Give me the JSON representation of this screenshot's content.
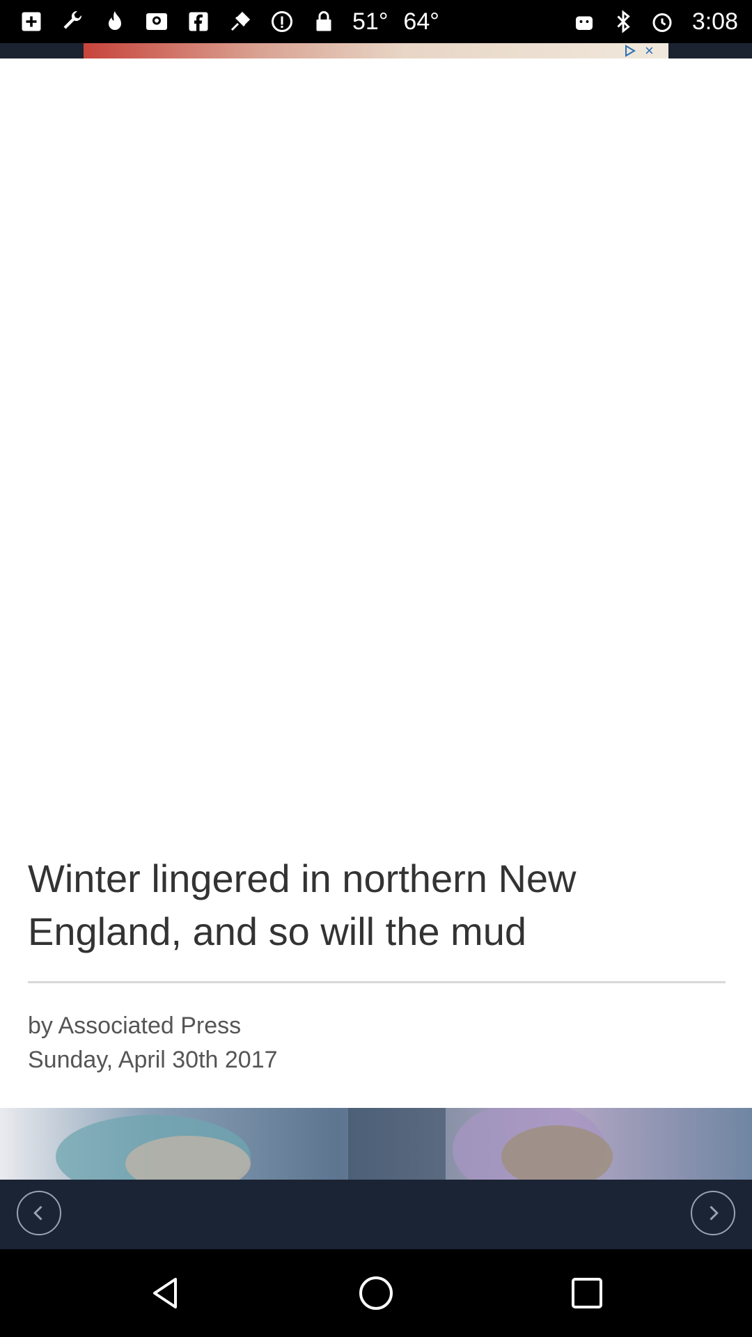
{
  "status_bar": {
    "icons_left": [
      "add-box-icon",
      "wrench-icon",
      "fire-icon",
      "inbox-icon",
      "facebook-icon",
      "fake-gps-icon",
      "info-icon",
      "lock-icon"
    ],
    "temp1": "51°",
    "temp2": "64°",
    "icons_right": [
      "android-icon",
      "bluetooth-icon",
      "alarm-icon"
    ],
    "time": "3:08"
  },
  "ad": {
    "close_symbol": "×"
  },
  "article": {
    "headline": "Winter lingered in northern New England, and so will the mud",
    "byline": "by Associated Press",
    "date": "Sunday, April 30th 2017"
  },
  "colors": {
    "nav_bg": "#1b2434",
    "headline_color": "#333333",
    "meta_color": "#555555"
  }
}
